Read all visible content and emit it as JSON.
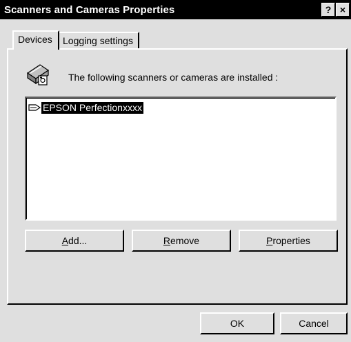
{
  "window": {
    "title": "Scanners and Cameras Properties",
    "help_glyph": "?",
    "close_glyph": "×"
  },
  "tabs": [
    {
      "label": "Devices",
      "active": true
    },
    {
      "label": "Logging settings",
      "active": false
    }
  ],
  "devices": {
    "heading": "The following scanners or cameras are installed :",
    "items": [
      {
        "label": "EPSON Perfectionxxxx",
        "selected": true,
        "icon": "scanner-arrow-icon"
      }
    ],
    "buttons": {
      "add": {
        "mnemonic": "A",
        "rest": "dd..."
      },
      "remove": {
        "mnemonic": "R",
        "rest": "emove"
      },
      "properties": {
        "mnemonic": "P",
        "rest": "roperties"
      }
    }
  },
  "footer": {
    "ok_label": "OK",
    "cancel_label": "Cancel"
  },
  "colors": {
    "titlebar": "#000000",
    "face": "#dfdfdf",
    "selection": "#000000"
  }
}
